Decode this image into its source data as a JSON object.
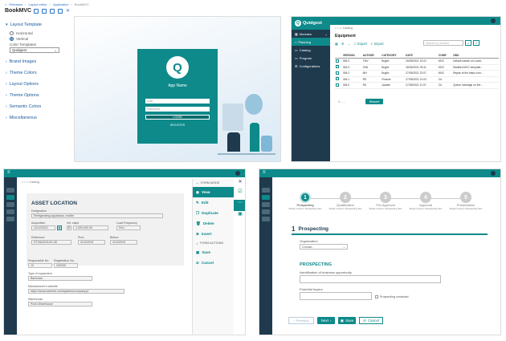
{
  "breadcrumb": {
    "home": "Releases",
    "c1": "Layout editor",
    "c2": "Application",
    "c3": "BookMVC"
  },
  "app_title": "BookMVC",
  "left_panel": {
    "layout_template": "Layout Template",
    "horizontal": "Horizontal",
    "vertical": "Vertical",
    "color_templates": "Color Templates",
    "color_value": "Quidgest",
    "brand_images": "Brand Images",
    "theme_colors": "Theme Colors",
    "layout_options": "Layout Options",
    "theme_options": "Theme Options",
    "semantic_colors": "Semantic Colors",
    "miscellaneous": "Miscellaneous"
  },
  "login": {
    "app_name": "App Name",
    "user_placeholder": "User",
    "password_placeholder": "Password",
    "login_button": "LOGIN",
    "register": "REGISTER"
  },
  "list_panel": {
    "brand": "Quidgest",
    "modules": "Modules",
    "planning": "Planning",
    "catalog": "Catalog",
    "program": "Program",
    "configurations": "Configurations",
    "crumb": "Catalog",
    "title": "Equipment",
    "search_placeholder": "Search by Version",
    "export": "Export",
    "import": "Import",
    "columns": [
      "VERSION",
      "AUTHOR",
      "CATEGORY",
      "DATE",
      "COMP.",
      "OBS."
    ],
    "rows": [
      [
        "306.4",
        "TMV",
        "Bugfix",
        "26/05/2021 10:02",
        "MVC",
        "Default values on Loadi..."
      ],
      [
        "306.3",
        "JNN",
        "Bugfix",
        "26/05/2021 09:41",
        "MVC",
        "Modified MVC template..."
      ],
      [
        "306.2",
        "MH",
        "Bugfix",
        "27/05/2021 22:07",
        "MVC",
        "Repair of the basic com..."
      ],
      [
        "306.1",
        "RS",
        "Feature",
        "27/05/2021 21:03",
        "C#",
        ""
      ],
      [
        "306.0",
        "RS",
        "Update",
        "27/05/2021 11:37",
        "C#",
        "Queue message on the..."
      ]
    ],
    "pager": "1 - ...",
    "insert": "Insert"
  },
  "form_panel": {
    "crumb": "Catalog",
    "section": "ASSET LOCATION",
    "designation_lbl": "Designation",
    "designation_val": "Refrigerating apparatus, mobile",
    "acquisition_lbl": "Acquisition",
    "acquisition_val": "12/12/2021",
    "init_value_lbl": "Init. value",
    "init_value_val": "1,000,000.00",
    "load_freq_lbl": "Load Frequency",
    "load_freq_val": "Peri...",
    "reference_lbl": "Reference",
    "reference_val": "ST/06/2021/01-08",
    "prev_lbl": "Prev.",
    "prev_val": "4/14/2015",
    "before_lbl": "Before",
    "before_val": "4/14/2015",
    "responsible_lbl": "Responsible No.",
    "responsible_val": "10",
    "registration_lbl": "Registration No.",
    "registration_val": "200030",
    "type_lbl": "Type of equipment",
    "type_val": "Barbrown",
    "manufacturer_lbl": "Manufacturer's website",
    "manufacturer_val": "https://www.sammie.com/systemscompany.pt",
    "warehouse_lbl": "Warehouse",
    "warehouse_val": "Porto Warehouse",
    "form_mode": "FORM MODE",
    "view": "View",
    "edit": "Edit",
    "duplicate": "Duplicate",
    "delete": "Delete",
    "insert": "Insert",
    "form_actions": "FORM ACTIONS",
    "save": "Save",
    "cancel": "Cancel"
  },
  "wizard_panel": {
    "steps": [
      {
        "n": "1",
        "label": "Prospecting",
        "sub": "Phase Control / Prospecting Text"
      },
      {
        "n": "2",
        "label": "Qualification",
        "sub": "Phase Control / Prospecting Text"
      },
      {
        "n": "3",
        "label": "Pre-Approval",
        "sub": "Phase Control / Prospecting Text"
      },
      {
        "n": "4",
        "label": "Approval",
        "sub": "Phase Control / Prospecting Text"
      },
      {
        "n": "5",
        "label": "Presentation",
        "sub": "Phase Control / Prospecting Text"
      }
    ],
    "step_title_num": "1",
    "step_title": "Prospecting",
    "organization": "Organization",
    "choose": "Choose...",
    "prospecting_heading": "PROSPECTING",
    "identification": "Identification of business opportunity",
    "potential_buyers": "Potential buyers",
    "checkbox_label": "Prospecting contacted",
    "previous": "Previous",
    "next": "Next",
    "save": "Save",
    "cancel": "Cancel"
  }
}
